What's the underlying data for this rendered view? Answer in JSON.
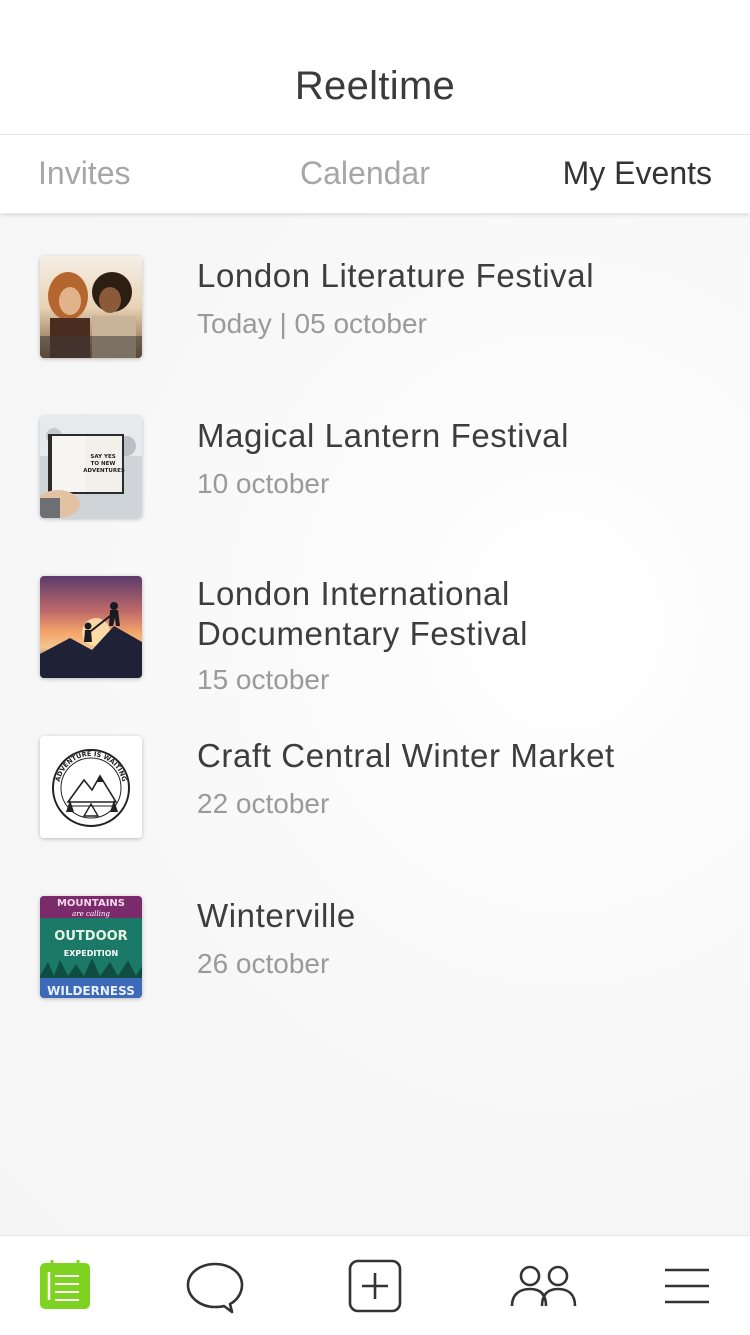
{
  "header": {
    "title": "Reeltime"
  },
  "tabs": [
    {
      "label": "Invites",
      "active": false
    },
    {
      "label": "Calendar",
      "active": false
    },
    {
      "label": "My Events",
      "active": true
    }
  ],
  "events": [
    {
      "title": "London Literature Festival",
      "date": "Today | 05 october",
      "thumbnail": "two-women-selfie-photo"
    },
    {
      "title": "Magical Lantern Festival",
      "date": "10 october",
      "thumbnail": "notebook-photo"
    },
    {
      "title": "London International Documentary Festival",
      "date": "15 october",
      "thumbnail": "hikers-sunset-photo"
    },
    {
      "title": "Craft Central Winter Market",
      "date": "22 october",
      "thumbnail": "adventure-badge-illustration"
    },
    {
      "title": "Winterville",
      "date": "26 october",
      "thumbnail": "outdoor-poster-illustration"
    }
  ],
  "thumb_text": {
    "notebook": "SAY YES TO NEW ADVENTURES",
    "badge": "ADVENTURE IS WAITING",
    "poster_top": "MOUNTAINS",
    "poster_calling": "are calling",
    "poster_outdoor": "OUTDOOR",
    "poster_expedition": "EXPEDITION",
    "poster_wilderness": "WILDERNESS"
  },
  "bottom_nav": [
    {
      "icon": "calendar-list-icon",
      "active": true
    },
    {
      "icon": "chat-bubble-icon",
      "active": false
    },
    {
      "icon": "add-square-icon",
      "active": false
    },
    {
      "icon": "people-icon",
      "active": false
    },
    {
      "icon": "menu-icon",
      "active": false
    }
  ],
  "colors": {
    "accent": "#7ed321",
    "text_primary": "#3d3d3d",
    "text_secondary": "#9a9a9a",
    "tab_inactive": "#a6a6a6"
  }
}
